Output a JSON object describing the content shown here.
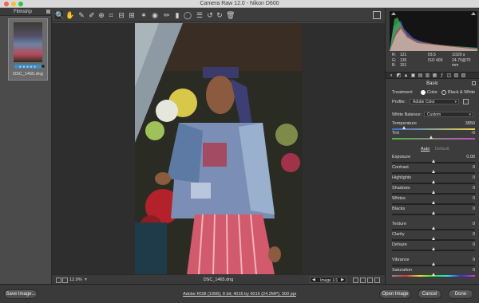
{
  "window": {
    "title": "Camera Raw 12.0  -  Nikon D600"
  },
  "filmstrip": {
    "title": "Filmstrip",
    "thumbnail": {
      "filename": "DSC_1465.dng",
      "rating": "★★★★★"
    }
  },
  "toolbar": {
    "tools": [
      {
        "name": "zoom-tool-icon",
        "glyph": "🔍"
      },
      {
        "name": "hand-tool-icon",
        "glyph": "✋"
      },
      {
        "name": "white-balance-tool-icon",
        "glyph": "✎"
      },
      {
        "name": "color-sampler-icon",
        "glyph": "✐"
      },
      {
        "name": "targeted-adjustment-icon",
        "glyph": "⊕"
      },
      {
        "name": "crop-tool-icon",
        "glyph": "⌗"
      },
      {
        "name": "straighten-tool-icon",
        "glyph": "⊟"
      },
      {
        "name": "transform-tool-icon",
        "glyph": "⊞"
      },
      {
        "name": "spot-removal-icon",
        "glyph": "✶"
      },
      {
        "name": "red-eye-icon",
        "glyph": "◉"
      },
      {
        "name": "adjustment-brush-icon",
        "glyph": "✏"
      },
      {
        "name": "graduated-filter-icon",
        "glyph": "▮"
      },
      {
        "name": "radial-filter-icon",
        "glyph": "◯"
      },
      {
        "name": "preferences-icon",
        "glyph": "☰"
      },
      {
        "name": "rotate-left-icon",
        "glyph": "↺"
      },
      {
        "name": "rotate-right-icon",
        "glyph": "↻"
      },
      {
        "name": "trash-icon",
        "glyph": "🗑"
      }
    ]
  },
  "status": {
    "zoom": "12.9%",
    "filename": "DSC_1465.dng",
    "image_counter": "Image 1/1"
  },
  "info": {
    "r": "R:",
    "r_val": "121",
    "g": "G:",
    "g_val": "135",
    "b": "B:",
    "b_val": "151",
    "aperture": "f/3.5",
    "shutter": "1/320 s",
    "iso": "ISO 400",
    "lens": "24-70@70 mm"
  },
  "panel": {
    "section_title": "Basic",
    "treatment_label": "Treatment:",
    "treatment_color": "Color",
    "treatment_bw": "Black & White",
    "profile_label": "Profile:",
    "profile_value": "Adobe Color",
    "wb_label": "White Balance:",
    "wb_value": "Custom",
    "temperature_label": "Temperature",
    "temperature_value": "3850",
    "tint_label": "Tint",
    "tint_value": "-6",
    "auto_label": "Auto",
    "default_label": "Default",
    "exposure_label": "Exposure",
    "exposure_value": "0.00",
    "contrast_label": "Contrast",
    "contrast_value": "0",
    "highlights_label": "Highlights",
    "highlights_value": "0",
    "shadows_label": "Shadows",
    "shadows_value": "0",
    "whites_label": "Whites",
    "whites_value": "0",
    "blacks_label": "Blacks",
    "blacks_value": "0",
    "texture_label": "Texture",
    "texture_value": "0",
    "clarity_label": "Clarity",
    "clarity_value": "0",
    "dehaze_label": "Dehaze",
    "dehaze_value": "0",
    "vibrance_label": "Vibrance",
    "vibrance_value": "0",
    "saturation_label": "Saturation",
    "saturation_value": "0"
  },
  "slider_levels": {
    "temperature": 0.15,
    "tint": 0.48,
    "exposure": 0.5,
    "contrast": 0.5,
    "highlights": 0.5,
    "shadows": 0.5,
    "whites": 0.5,
    "blacks": 0.5,
    "texture": 0.5,
    "clarity": 0.5,
    "dehaze": 0.5,
    "vibrance": 0.5,
    "saturation": 0.5
  },
  "bottom": {
    "save_label": "Save Image...",
    "workflow_link": "Adobe RGB (1998); 8 bit; 4016 by 6016 (24.2MP); 300 ppi",
    "open_label": "Open Image",
    "cancel_label": "Cancel",
    "done_label": "Done"
  },
  "colors": {
    "accent": "#3d8fc6",
    "background": "#4a4a4a",
    "panel": "#3c3c3c"
  }
}
